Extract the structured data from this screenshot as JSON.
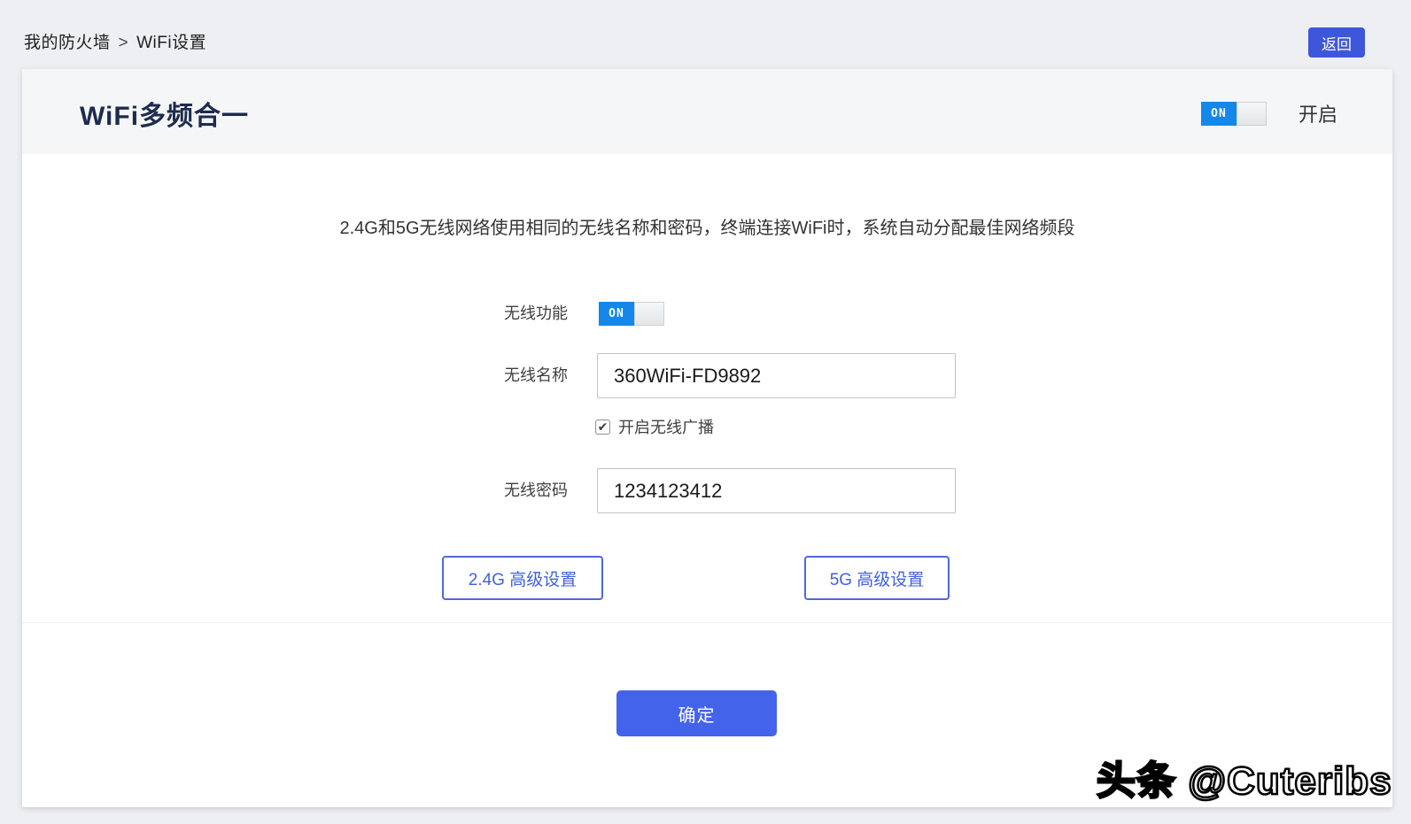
{
  "colors": {
    "page_background": "#edeff2",
    "panel_background": "#ffffff",
    "panel_header_background": "#f5f6f7",
    "back_button_blue": "#3e57da",
    "confirm_button_blue": "#4364ea",
    "advanced_button_blue": "#4161dd",
    "toggle_on_blue": "#1487e8",
    "title_color": "#1d2b4f"
  },
  "breadcrumb": {
    "parent": "我的防火墙",
    "separator": ">",
    "current": "WiFi设置"
  },
  "top_bar": {
    "back_button_label": "返回"
  },
  "panel": {
    "title": "WiFi多频合一",
    "master_toggle": {
      "on_label": "ON",
      "state_label": "开启"
    },
    "description": "2.4G和5G无线网络使用相同的无线名称和密码，终端连接WiFi时，系统自动分配最佳网络频段",
    "form": {
      "wireless_function_label": "无线功能",
      "wireless_function_toggle_on": "ON",
      "wireless_name_label": "无线名称",
      "wireless_name_value": "360WiFi-FD9892",
      "broadcast_label": "开启无线广播",
      "broadcast_checked": true,
      "check_glyph": "✔",
      "wireless_password_label": "无线密码",
      "wireless_password_value": "1234123412",
      "advanced_24g_label": "2.4G 高级设置",
      "advanced_5g_label": "5G 高级设置",
      "confirm_label": "确定"
    }
  },
  "watermark": "头条 @Cuteribs"
}
